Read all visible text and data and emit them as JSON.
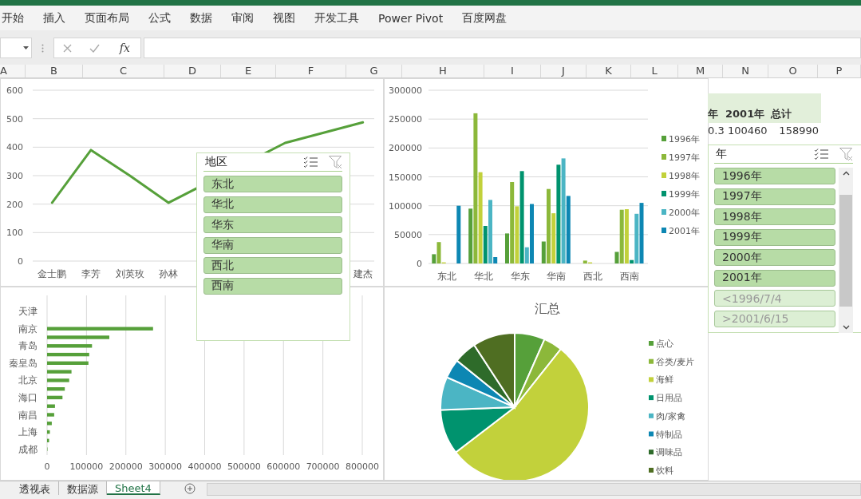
{
  "ribbon": {
    "tabs": [
      {
        "label": "开始",
        "selected": false
      },
      {
        "label": "插入",
        "selected": false
      },
      {
        "label": "页面布局",
        "selected": false
      },
      {
        "label": "公式",
        "selected": false
      },
      {
        "label": "数据",
        "selected": false
      },
      {
        "label": "审阅",
        "selected": false
      },
      {
        "label": "视图",
        "selected": false
      },
      {
        "label": "开发工具",
        "selected": false
      },
      {
        "label": "Power Pivot",
        "selected": false
      },
      {
        "label": "百度网盘",
        "selected": false
      }
    ]
  },
  "formula_bar": {
    "function_label": "fx"
  },
  "column_headers": [
    "A",
    "B",
    "C",
    "D",
    "E",
    "F",
    "G",
    "H",
    "I",
    "J",
    "K",
    "L",
    "M",
    "N",
    "O",
    "P"
  ],
  "pivot_table": {
    "columns": [
      "年",
      "2001年",
      "总计"
    ],
    "rows": [
      [
        "0.3",
        "100460",
        "158990"
      ]
    ]
  },
  "charts": [
    {
      "chart_data": {
        "type": "line",
        "categories": [
          "金士鹏",
          "李芳",
          "刘英玫",
          "孙林",
          null,
          null,
          null,
          null,
          "建杰"
        ],
        "ylim": [
          0,
          600
        ],
        "yticks": [
          0,
          100,
          200,
          300,
          400,
          500,
          600
        ],
        "grid": true,
        "series": [
          {
            "color": "#56a03a",
            "values": [
              205,
              390,
              300,
              205,
              null,
              null,
              415,
              null,
              487
            ]
          }
        ]
      }
    },
    {
      "chart_data": {
        "type": "bar",
        "orientation": "vertical",
        "categories": [
          "东北",
          "华北",
          "华东",
          "华南",
          "西北",
          "西南"
        ],
        "ylim": [
          0,
          300000
        ],
        "yticks": [
          0,
          50000,
          100000,
          150000,
          200000,
          250000,
          300000
        ],
        "grid": true,
        "legend": "right",
        "series": [
          {
            "name": "1996年",
            "color": "#56a03a",
            "values": [
              16000,
              95000,
              52000,
              38000,
              null,
              20000
            ]
          },
          {
            "name": "1997年",
            "color": "#8cb83a",
            "values": [
              37000,
              260000,
              141000,
              129000,
              5000,
              93000
            ]
          },
          {
            "name": "1998年",
            "color": "#c2d13b",
            "values": [
              2000,
              158000,
              99000,
              87000,
              2000,
              94000
            ]
          },
          {
            "name": "1999年",
            "color": "#00936e",
            "values": [
              null,
              65000,
              160000,
              171000,
              null,
              6000
            ]
          },
          {
            "name": "2000年",
            "color": "#4bb5c4",
            "values": [
              null,
              110000,
              28000,
              182000,
              null,
              86000
            ]
          },
          {
            "name": "2001年",
            "color": "#0d87b3",
            "values": [
              100000,
              11000,
              103000,
              117000,
              null,
              105000
            ]
          }
        ]
      }
    },
    {
      "chart_data": {
        "type": "bar",
        "orientation": "horizontal",
        "categories": [
          null,
          "天津",
          null,
          "南京",
          null,
          "青岛",
          null,
          "秦皇岛",
          null,
          "北京",
          null,
          "海口",
          null,
          "南昌",
          null,
          "上海",
          null,
          "成都"
        ],
        "xlim": [
          0,
          800000
        ],
        "grid": true,
        "xticks": [
          0,
          100000,
          200000,
          300000,
          400000,
          500000,
          600000,
          700000,
          800000
        ],
        "series": [
          {
            "color": "#56a03a",
            "values": [
              null,
              null,
              null,
              269000,
              158000,
              114000,
              107000,
              105000,
              62000,
              56000,
              45000,
              39000,
              20000,
              18000,
              12000,
              7000,
              5000,
              1000
            ]
          }
        ]
      }
    },
    {
      "chart_data": {
        "type": "pie",
        "title": "汇总",
        "legend": "right",
        "categories": [
          "点心",
          "谷类/麦片",
          "海鲜",
          "日用品",
          "肉/家禽",
          "特制品",
          "调味品",
          "饮料"
        ],
        "series": [
          {
            "colors": [
              "#56a03a",
              "#8cb83a",
              "#c2d13b",
              "#00936e",
              "#4bb5c4",
              "#0d87b3",
              "#2e6b2a",
              "#4f6e22"
            ],
            "values": [
              6.6,
              4.1,
              53.9,
              9.8,
              7.2,
              4.2,
              5.0,
              9.2
            ]
          }
        ]
      }
    }
  ],
  "slicers": [
    {
      "title": "地区",
      "scrollable": false,
      "items": [
        {
          "label": "东北",
          "selected": true
        },
        {
          "label": "华北",
          "selected": true
        },
        {
          "label": "华东",
          "selected": true
        },
        {
          "label": "华南",
          "selected": true
        },
        {
          "label": "西北",
          "selected": true
        },
        {
          "label": "西南",
          "selected": true
        }
      ]
    },
    {
      "title": "年",
      "scrollable": true,
      "items": [
        {
          "label": "1996年",
          "selected": true
        },
        {
          "label": "1997年",
          "selected": true
        },
        {
          "label": "1998年",
          "selected": true
        },
        {
          "label": "1999年",
          "selected": true
        },
        {
          "label": "2000年",
          "selected": true
        },
        {
          "label": "2001年",
          "selected": true
        },
        {
          "label": "<1996/7/4",
          "selected": false
        },
        {
          "label": ">2001/6/15",
          "selected": false
        }
      ]
    }
  ],
  "sheet_tabs": [
    {
      "label": "透视表",
      "selected": false
    },
    {
      "label": "数据源",
      "selected": false
    },
    {
      "label": "Sheet4",
      "selected": true
    }
  ]
}
